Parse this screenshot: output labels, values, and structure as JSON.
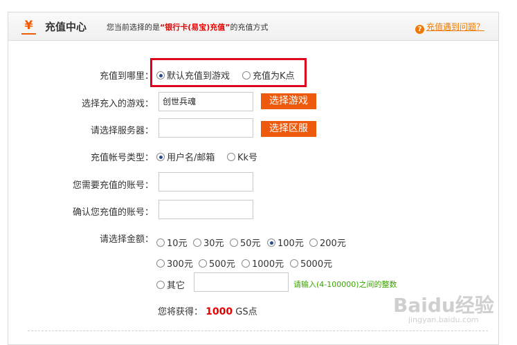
{
  "header": {
    "icon": "yen-icon",
    "title": "充值中心",
    "subtitle_prefix": "您当前选择的是",
    "subtitle_highlight": "“银行卡(易宝)充值”",
    "subtitle_suffix": "的充值方式",
    "help_icon": "question-circle-icon",
    "help_link": "充值遇到问题？"
  },
  "form": {
    "target_label": "充值到哪里：",
    "target_options": [
      {
        "label": "默认充值到游戏",
        "selected": true
      },
      {
        "label": "充值为K点",
        "selected": false
      }
    ],
    "game_label": "选择充入的游戏：",
    "game_value": "创世兵魂",
    "choose_game_button": "选择游戏",
    "server_label": "请选择服务器：",
    "server_value": "",
    "choose_server_button": "选择区服",
    "account_type_label": "充值帐号类型：",
    "account_type_options": [
      {
        "label": "用户名/邮箱",
        "selected": true
      },
      {
        "label": "Kk号",
        "selected": false
      }
    ],
    "account_label": "您需要充值的账号：",
    "account_value": "",
    "confirm_label": "确认您充值的账号：",
    "confirm_value": "",
    "amount_label": "请选择金额：",
    "amounts_row1": [
      {
        "label": "10元",
        "selected": false
      },
      {
        "label": "30元",
        "selected": false
      },
      {
        "label": "50元",
        "selected": false
      },
      {
        "label": "100元",
        "selected": true
      },
      {
        "label": "200元",
        "selected": false
      }
    ],
    "amounts_row2": [
      {
        "label": "300元",
        "selected": false
      },
      {
        "label": "500元",
        "selected": false
      },
      {
        "label": "1000元",
        "selected": false
      },
      {
        "label": "5000元",
        "selected": false
      }
    ],
    "other_label": "其它",
    "other_value": "",
    "other_hint": "请输入(4-100000)之间的整数",
    "earn_prefix": "您将获得：",
    "earn_amount": "1000",
    "earn_unit": "GS点"
  },
  "watermark": {
    "text": "Baidu经验",
    "url": "jingyan.baidu.com"
  },
  "colors": {
    "accent": "#ee5a0c",
    "highlight": "#e60000",
    "hint": "#3aa300",
    "radio_selected": "#2a4e8c"
  }
}
